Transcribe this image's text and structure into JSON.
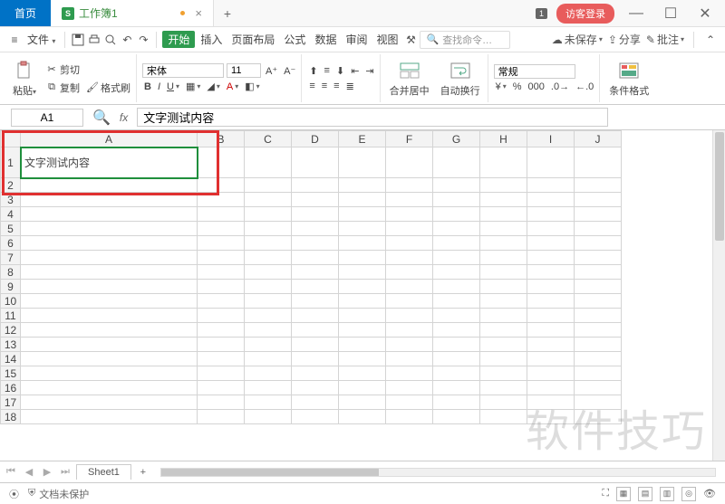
{
  "titlebar": {
    "home_tab": "首页",
    "doc_tab": "工作簿1",
    "doc_icon_letter": "S",
    "badge": "1",
    "login": "访客登录"
  },
  "menubar": {
    "file": "文件",
    "start": "开始",
    "insert": "插入",
    "page_layout": "页面布局",
    "formula": "公式",
    "data": "数据",
    "review": "审阅",
    "view": "视图",
    "search_placeholder": "查找命令…",
    "unsaved": "未保存",
    "share": "分享",
    "annotate": "批注"
  },
  "ribbon": {
    "paste": "粘贴",
    "cut": "剪切",
    "copy": "复制",
    "format_painter": "格式刷",
    "font_name": "宋体",
    "font_size": "11",
    "merge_center": "合并居中",
    "wrap_text": "自动换行",
    "number_format": "常规",
    "cond_format": "条件格式"
  },
  "namebar": {
    "cell_ref": "A1",
    "fx": "fx",
    "formula_value": "文字测试内容"
  },
  "grid": {
    "columns": [
      "A",
      "B",
      "C",
      "D",
      "E",
      "F",
      "G",
      "H",
      "I",
      "J"
    ],
    "rows": [
      1,
      2,
      3,
      4,
      5,
      6,
      7,
      8,
      9,
      10,
      11,
      12,
      13,
      14,
      15,
      16,
      17,
      18
    ],
    "a1_value": "文字测试内容"
  },
  "sheet_tabs": {
    "active": "Sheet1"
  },
  "statusbar": {
    "protect": "文档未保护"
  },
  "watermark": "软件技巧"
}
